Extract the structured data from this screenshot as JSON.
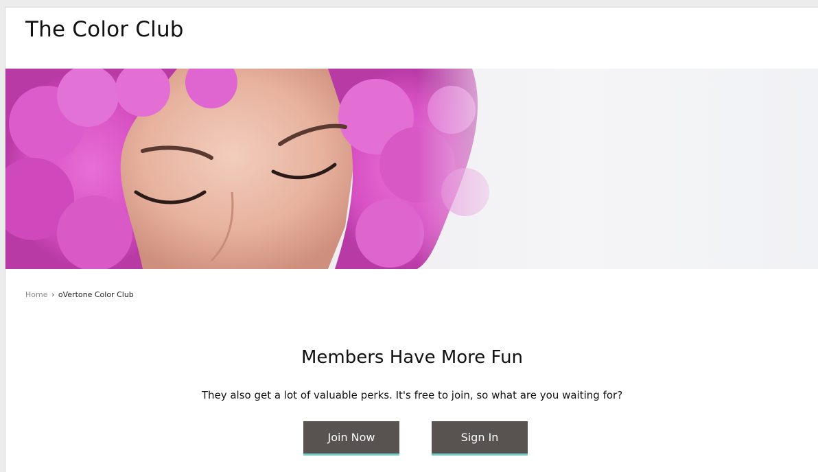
{
  "header": {
    "site_title": "The Color Club"
  },
  "breadcrumb": {
    "home": "Home",
    "separator": "›",
    "current": "oVertone Color Club"
  },
  "main": {
    "headline": "Members Have More Fun",
    "subline": "They also get a lot of valuable perks. It's free to join, so what are you waiting for?",
    "join_label": "Join Now",
    "signin_label": "Sign In"
  },
  "colors": {
    "button_bg": "#585250",
    "button_accent": "#6ec9c2",
    "hair": "#d64fc2"
  }
}
